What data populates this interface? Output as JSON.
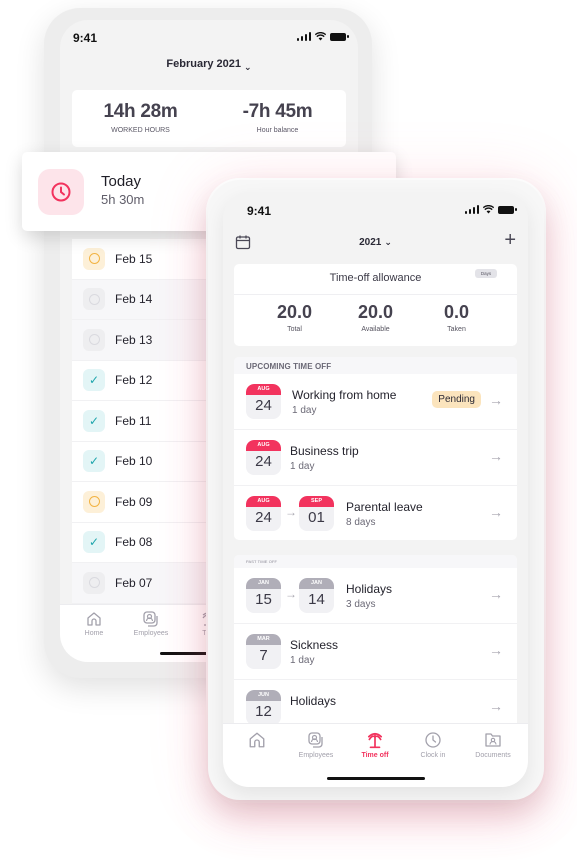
{
  "back_phone": {
    "status_time": "9:41",
    "month_selector": "February 2021",
    "stats": [
      {
        "value": "14h 28m",
        "label": "WORKED HOURS"
      },
      {
        "value": "-7h 45m",
        "label": "Hour balance"
      }
    ],
    "days": [
      {
        "label": "Feb 15",
        "status": "pending"
      },
      {
        "label": "Feb 14",
        "status": "empty"
      },
      {
        "label": "Feb 13",
        "status": "empty"
      },
      {
        "label": "Feb 12",
        "status": "done"
      },
      {
        "label": "Feb 11",
        "status": "done"
      },
      {
        "label": "Feb 10",
        "status": "done"
      },
      {
        "label": "Feb 09",
        "status": "pending"
      },
      {
        "label": "Feb 08",
        "status": "done"
      },
      {
        "label": "Feb 07",
        "status": "empty"
      }
    ],
    "tabs": [
      {
        "label": "Home",
        "icon": "home-icon"
      },
      {
        "label": "Employees",
        "icon": "employees-icon"
      },
      {
        "label": "Tim",
        "icon": "palm-tree-icon"
      }
    ]
  },
  "today_card": {
    "title": "Today",
    "value": "5h 30m",
    "icon": "clock-icon",
    "accent": "#f2335e"
  },
  "front_phone": {
    "status_time": "9:41",
    "year_selector": "2021",
    "allowance": {
      "title": "Time-off allowance",
      "unit_chip": "Days",
      "stats": [
        {
          "value": "20.0",
          "label": "Total"
        },
        {
          "value": "20.0",
          "label": "Available"
        },
        {
          "value": "0.0",
          "label": "Taken"
        }
      ]
    },
    "upcoming": {
      "header": "UPCOMING TIME OFF",
      "items": [
        {
          "start_month": "AUG",
          "start_day": "24",
          "title": "Working from home",
          "duration": "1 day",
          "status": "Pending"
        },
        {
          "start_month": "AUG",
          "start_day": "24",
          "title": "Business trip",
          "duration": "1 day"
        },
        {
          "start_month": "AUG",
          "start_day": "24",
          "end_month": "SEP",
          "end_day": "01",
          "title": "Parental leave",
          "duration": "8 days"
        }
      ]
    },
    "past": {
      "header": "PAST TIME OFF",
      "items": [
        {
          "start_month": "JAN",
          "start_day": "15",
          "end_month": "JAN",
          "end_day": "14",
          "title": "Holidays",
          "duration": "3 days"
        },
        {
          "start_month": "MAR",
          "start_day": "7",
          "title": "Sickness",
          "duration": "1 day"
        },
        {
          "start_month": "JUN",
          "start_day": "12",
          "title": "Holidays",
          "duration": ""
        }
      ]
    },
    "tabs": [
      {
        "label": "Home",
        "icon": "home-icon"
      },
      {
        "label": "Employees",
        "icon": "employees-icon"
      },
      {
        "label": "Time off",
        "icon": "palm-tree-icon",
        "active": true
      },
      {
        "label": "Clock in",
        "icon": "clock-icon"
      },
      {
        "label": "Documents",
        "icon": "documents-icon"
      }
    ],
    "accent": "#f2335e"
  }
}
